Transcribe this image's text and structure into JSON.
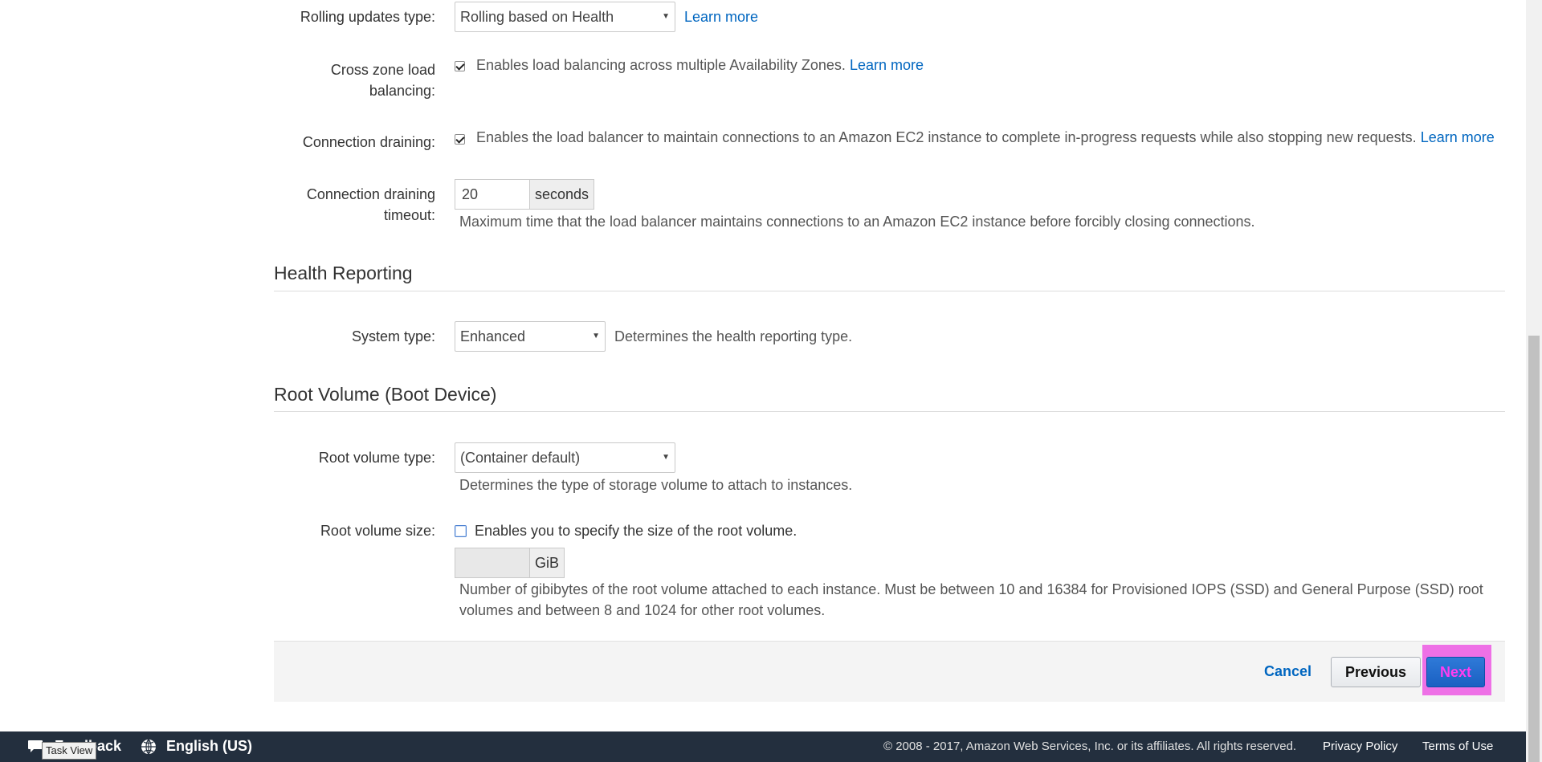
{
  "rolling_updates": {
    "label": "Rolling updates type:",
    "selected": "Rolling based on Health",
    "learn_more": "Learn more"
  },
  "cross_zone": {
    "label_line1": "Cross zone load",
    "label_line2": "balancing:",
    "checked": true,
    "text": "Enables load balancing across multiple Availability Zones.",
    "learn_more": "Learn more"
  },
  "connection_draining": {
    "label": "Connection draining:",
    "checked": true,
    "text": "Enables the load balancer to maintain connections to an Amazon EC2 instance to complete in-progress requests while also stopping new requests.",
    "learn_more": "Learn more"
  },
  "draining_timeout": {
    "label_line1": "Connection draining",
    "label_line2": "timeout:",
    "value": "20",
    "unit": "seconds",
    "help": "Maximum time that the load balancer maintains connections to an Amazon EC2 instance before forcibly closing connections."
  },
  "health_reporting": {
    "title": "Health Reporting",
    "system_type_label": "System type:",
    "system_type_selected": "Enhanced",
    "system_type_help": "Determines the health reporting type."
  },
  "root_volume": {
    "title": "Root Volume (Boot Device)",
    "type_label": "Root volume type:",
    "type_selected": "(Container default)",
    "type_help": "Determines the type of storage volume to attach to instances.",
    "size_label": "Root volume size:",
    "size_checked": false,
    "size_checkbox_text": "Enables you to specify the size of the root volume.",
    "size_value": "",
    "size_unit": "GiB",
    "size_help_line1": "Number of gibibytes of the root volume attached to each instance. Must be between 10 and 16384 for Provisioned IOPS (SSD) and General Purpose (SSD) root",
    "size_help_line2": "volumes and between 8 and 1024 for other root volumes."
  },
  "actions": {
    "cancel": "Cancel",
    "previous": "Previous",
    "next": "Next"
  },
  "footer": {
    "feedback": "Feedback",
    "language": "English (US)",
    "copyright": "© 2008 - 2017, Amazon Web Services, Inc. or its affiliates. All rights reserved.",
    "privacy": "Privacy Policy",
    "terms": "Terms of Use"
  },
  "tooltip": "Task View",
  "icons": {
    "select_caret": "▾",
    "globe": "globe-icon",
    "feedback": "speech-bubble-icon"
  }
}
